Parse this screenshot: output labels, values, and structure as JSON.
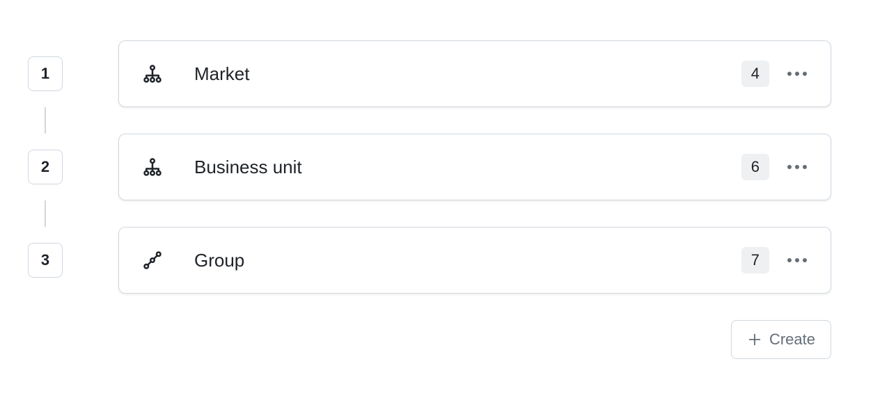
{
  "levels": [
    {
      "number": "1",
      "label": "Market",
      "count": "4",
      "icon": "hierarchy"
    },
    {
      "number": "2",
      "label": "Business unit",
      "count": "6",
      "icon": "hierarchy"
    },
    {
      "number": "3",
      "label": "Group",
      "count": "7",
      "icon": "connected-nodes"
    }
  ],
  "actions": {
    "create_label": "Create"
  }
}
